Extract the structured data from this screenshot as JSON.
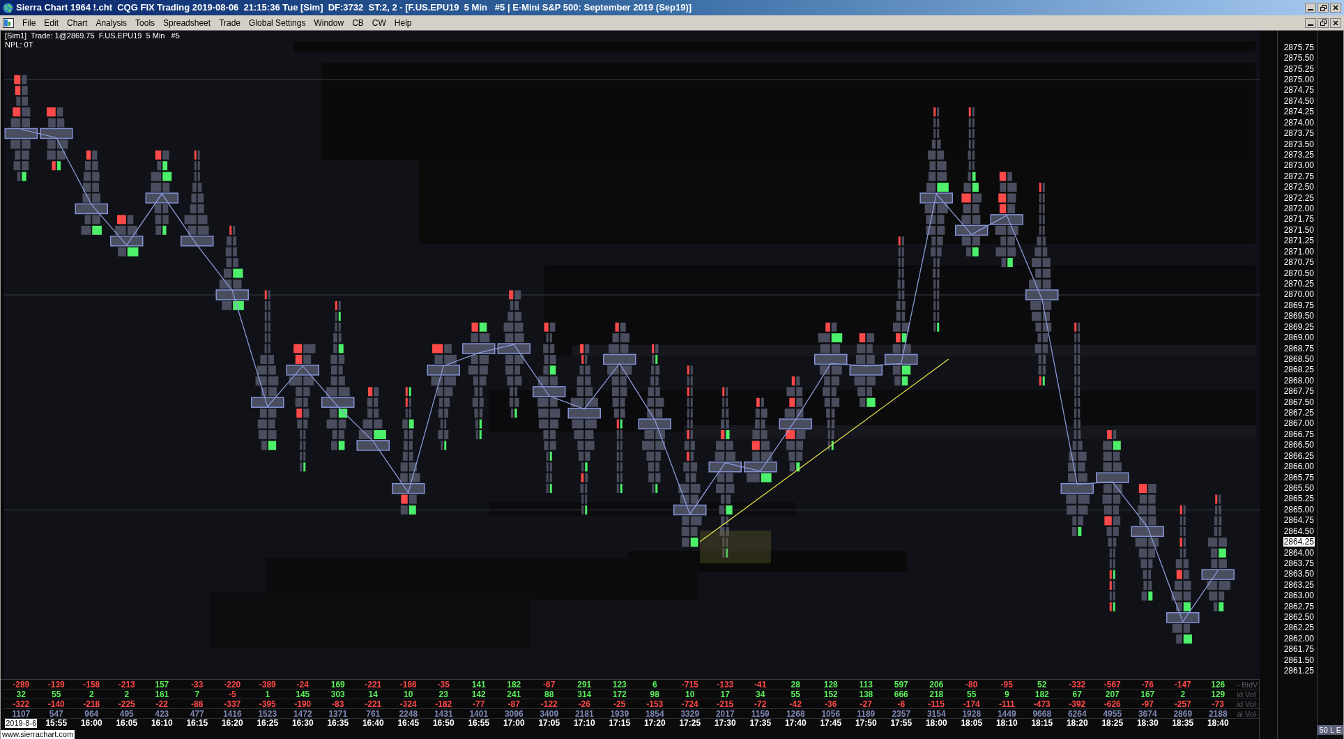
{
  "title_bar": {
    "title": "Sierra Chart 1964 !.cht  CQG FIX Trading 2019-08-06  21:15:36 Tue [Sim]  DF:3732  ST:2, 2 - [F.US.EPU19  5 Min   #5 | E-Mini S&P 500: September 2019 (Sep19)]"
  },
  "menu": [
    "File",
    "Edit",
    "Chart",
    "Analysis",
    "Tools",
    "Spreadsheet",
    "Trade",
    "Global Settings",
    "Window",
    "CB",
    "CW",
    "Help"
  ],
  "chart_info": {
    "line_1": "[Sim1]  Trade: 1@2869.75  F.US.EPU19  5 Min   #5",
    "line_2": "NPL: 0T"
  },
  "price_axis": [
    {
      "label": "2875.75",
      "current": false
    },
    {
      "label": "2875.50",
      "current": false
    },
    {
      "label": "2875.25",
      "current": false
    },
    {
      "label": "2875.00",
      "current": false
    },
    {
      "label": "2874.75",
      "current": false
    },
    {
      "label": "2874.50",
      "current": false
    },
    {
      "label": "2874.25",
      "current": false
    },
    {
      "label": "2874.00",
      "current": false
    },
    {
      "label": "2873.75",
      "current": false
    },
    {
      "label": "2873.50",
      "current": false
    },
    {
      "label": "2873.25",
      "current": false
    },
    {
      "label": "2873.00",
      "current": false
    },
    {
      "label": "2872.75",
      "current": false
    },
    {
      "label": "2872.50",
      "current": false
    },
    {
      "label": "2872.25",
      "current": false
    },
    {
      "label": "2872.00",
      "current": false
    },
    {
      "label": "2871.75",
      "current": false
    },
    {
      "label": "2871.50",
      "current": false
    },
    {
      "label": "2871.25",
      "current": false
    },
    {
      "label": "2871.00",
      "current": false
    },
    {
      "label": "2870.75",
      "current": false
    },
    {
      "label": "2870.50",
      "current": false
    },
    {
      "label": "2870.25",
      "current": false
    },
    {
      "label": "2870.00",
      "current": false
    },
    {
      "label": "2869.75",
      "current": false
    },
    {
      "label": "2869.50",
      "current": false
    },
    {
      "label": "2869.25",
      "current": false
    },
    {
      "label": "2869.00",
      "current": false
    },
    {
      "label": "2868.75",
      "current": false
    },
    {
      "label": "2868.50",
      "current": false
    },
    {
      "label": "2868.25",
      "current": false
    },
    {
      "label": "2868.00",
      "current": false
    },
    {
      "label": "2867.75",
      "current": false
    },
    {
      "label": "2867.50",
      "current": false
    },
    {
      "label": "2867.25",
      "current": false
    },
    {
      "label": "2867.00",
      "current": false
    },
    {
      "label": "2866.75",
      "current": false
    },
    {
      "label": "2866.50",
      "current": false
    },
    {
      "label": "2866.25",
      "current": false
    },
    {
      "label": "2866.00",
      "current": false
    },
    {
      "label": "2865.75",
      "current": false
    },
    {
      "label": "2865.50",
      "current": false
    },
    {
      "label": "2865.25",
      "current": false
    },
    {
      "label": "2865.00",
      "current": false
    },
    {
      "label": "2864.75",
      "current": false
    },
    {
      "label": "2864.50",
      "current": false
    },
    {
      "label": "2864.25",
      "current": true
    },
    {
      "label": "2864.00",
      "current": false
    },
    {
      "label": "2863.75",
      "current": false
    },
    {
      "label": "2863.50",
      "current": false
    },
    {
      "label": "2863.25",
      "current": false
    },
    {
      "label": "2863.00",
      "current": false
    },
    {
      "label": "2862.75",
      "current": false
    },
    {
      "label": "2862.50",
      "current": false
    },
    {
      "label": "2862.25",
      "current": false
    },
    {
      "label": "2862.00",
      "current": false
    },
    {
      "label": "2861.75",
      "current": false
    },
    {
      "label": "2861.50",
      "current": false
    },
    {
      "label": "2861.25",
      "current": false
    }
  ],
  "study_table": {
    "rows": [
      {
        "label": "- BidV",
        "cells": [
          {
            "value": "-289",
            "color": "#ff4848"
          },
          {
            "value": "-139",
            "color": "#ff4848"
          },
          {
            "value": "-158",
            "color": "#ff4848"
          },
          {
            "value": "-213",
            "color": "#ff4848"
          },
          {
            "value": "157",
            "color": "#5cf05c"
          },
          {
            "value": "-33",
            "color": "#ff4848"
          },
          {
            "value": "-220",
            "color": "#ff4848"
          },
          {
            "value": "-389",
            "color": "#ff4848"
          },
          {
            "value": "-24",
            "color": "#ff4848"
          },
          {
            "value": "169",
            "color": "#5cf05c"
          },
          {
            "value": "-221",
            "color": "#ff4848"
          },
          {
            "value": "-186",
            "color": "#ff4848"
          },
          {
            "value": "-35",
            "color": "#ff4848"
          },
          {
            "value": "141",
            "color": "#5cf05c"
          },
          {
            "value": "182",
            "color": "#5cf05c"
          },
          {
            "value": "-67",
            "color": "#ff4848"
          },
          {
            "value": "291",
            "color": "#5cf05c"
          },
          {
            "value": "123",
            "color": "#5cf05c"
          },
          {
            "value": "6",
            "color": "#5cf05c"
          },
          {
            "value": "-715",
            "color": "#ff4848"
          },
          {
            "value": "-133",
            "color": "#ff4848"
          },
          {
            "value": "-41",
            "color": "#ff4848"
          },
          {
            "value": "28",
            "color": "#5cf05c"
          },
          {
            "value": "128",
            "color": "#5cf05c"
          },
          {
            "value": "113",
            "color": "#5cf05c"
          },
          {
            "value": "597",
            "color": "#5cf05c"
          },
          {
            "value": "206",
            "color": "#5cf05c"
          },
          {
            "value": "-80",
            "color": "#ff4848"
          },
          {
            "value": "-95",
            "color": "#ff4848"
          },
          {
            "value": "52",
            "color": "#5cf05c"
          },
          {
            "value": "-332",
            "color": "#ff4848"
          },
          {
            "value": "-567",
            "color": "#ff4848"
          },
          {
            "value": "-76",
            "color": "#ff4848"
          },
          {
            "value": "-147",
            "color": "#ff4848"
          },
          {
            "value": "126",
            "color": "#5cf05c"
          }
        ]
      },
      {
        "label": "id Vol",
        "cells": [
          {
            "value": "32",
            "color": "#5cf05c"
          },
          {
            "value": "55",
            "color": "#5cf05c"
          },
          {
            "value": "2",
            "color": "#5cf05c"
          },
          {
            "value": "2",
            "color": "#5cf05c"
          },
          {
            "value": "161",
            "color": "#5cf05c"
          },
          {
            "value": "7",
            "color": "#5cf05c"
          },
          {
            "value": "-5",
            "color": "#ff4848"
          },
          {
            "value": "1",
            "color": "#5cf05c"
          },
          {
            "value": "145",
            "color": "#5cf05c"
          },
          {
            "value": "303",
            "color": "#5cf05c"
          },
          {
            "value": "14",
            "color": "#5cf05c"
          },
          {
            "value": "10",
            "color": "#5cf05c"
          },
          {
            "value": "23",
            "color": "#5cf05c"
          },
          {
            "value": "142",
            "color": "#5cf05c"
          },
          {
            "value": "241",
            "color": "#5cf05c"
          },
          {
            "value": "88",
            "color": "#5cf05c"
          },
          {
            "value": "314",
            "color": "#5cf05c"
          },
          {
            "value": "172",
            "color": "#5cf05c"
          },
          {
            "value": "98",
            "color": "#5cf05c"
          },
          {
            "value": "10",
            "color": "#5cf05c"
          },
          {
            "value": "17",
            "color": "#5cf05c"
          },
          {
            "value": "34",
            "color": "#5cf05c"
          },
          {
            "value": "55",
            "color": "#5cf05c"
          },
          {
            "value": "152",
            "color": "#5cf05c"
          },
          {
            "value": "138",
            "color": "#5cf05c"
          },
          {
            "value": "666",
            "color": "#5cf05c"
          },
          {
            "value": "218",
            "color": "#5cf05c"
          },
          {
            "value": "55",
            "color": "#5cf05c"
          },
          {
            "value": "9",
            "color": "#5cf05c"
          },
          {
            "value": "182",
            "color": "#5cf05c"
          },
          {
            "value": "67",
            "color": "#5cf05c"
          },
          {
            "value": "207",
            "color": "#5cf05c"
          },
          {
            "value": "167",
            "color": "#5cf05c"
          },
          {
            "value": "2",
            "color": "#5cf05c"
          },
          {
            "value": "129",
            "color": "#5cf05c"
          }
        ]
      },
      {
        "label": "id Vol",
        "cells": [
          {
            "value": "-322",
            "color": "#ff4848"
          },
          {
            "value": "-140",
            "color": "#ff4848"
          },
          {
            "value": "-218",
            "color": "#ff4848"
          },
          {
            "value": "-225",
            "color": "#ff4848"
          },
          {
            "value": "-22",
            "color": "#ff4848"
          },
          {
            "value": "-88",
            "color": "#ff4848"
          },
          {
            "value": "-337",
            "color": "#ff4848"
          },
          {
            "value": "-395",
            "color": "#ff4848"
          },
          {
            "value": "-190",
            "color": "#ff4848"
          },
          {
            "value": "-83",
            "color": "#ff4848"
          },
          {
            "value": "-221",
            "color": "#ff4848"
          },
          {
            "value": "-324",
            "color": "#ff4848"
          },
          {
            "value": "-182",
            "color": "#ff4848"
          },
          {
            "value": "-77",
            "color": "#ff4848"
          },
          {
            "value": "-87",
            "color": "#ff4848"
          },
          {
            "value": "-122",
            "color": "#ff4848"
          },
          {
            "value": "-26",
            "color": "#ff4848"
          },
          {
            "value": "-25",
            "color": "#ff4848"
          },
          {
            "value": "-153",
            "color": "#ff4848"
          },
          {
            "value": "-724",
            "color": "#ff4848"
          },
          {
            "value": "-215",
            "color": "#ff4848"
          },
          {
            "value": "-72",
            "color": "#ff4848"
          },
          {
            "value": "-42",
            "color": "#ff4848"
          },
          {
            "value": "-36",
            "color": "#ff4848"
          },
          {
            "value": "-27",
            "color": "#ff4848"
          },
          {
            "value": "-8",
            "color": "#ff4848"
          },
          {
            "value": "-115",
            "color": "#ff4848"
          },
          {
            "value": "-174",
            "color": "#ff4848"
          },
          {
            "value": "-111",
            "color": "#ff4848"
          },
          {
            "value": "-473",
            "color": "#ff4848"
          },
          {
            "value": "-392",
            "color": "#ff4848"
          },
          {
            "value": "-626",
            "color": "#ff4848"
          },
          {
            "value": "-97",
            "color": "#ff4848"
          },
          {
            "value": "-257",
            "color": "#ff4848"
          },
          {
            "value": "-73",
            "color": "#ff4848"
          }
        ]
      },
      {
        "label": "al Vol",
        "cells": [
          {
            "value": "1107",
            "color": "#7d87b5"
          },
          {
            "value": "547",
            "color": "#7d87b5"
          },
          {
            "value": "964",
            "color": "#7d87b5"
          },
          {
            "value": "495",
            "color": "#7d87b5"
          },
          {
            "value": "423",
            "color": "#7d87b5"
          },
          {
            "value": "477",
            "color": "#7d87b5"
          },
          {
            "value": "1416",
            "color": "#7d87b5"
          },
          {
            "value": "1523",
            "color": "#7d87b5"
          },
          {
            "value": "1472",
            "color": "#7d87b5"
          },
          {
            "value": "1371",
            "color": "#7d87b5"
          },
          {
            "value": "761",
            "color": "#7d87b5"
          },
          {
            "value": "2248",
            "color": "#7d87b5"
          },
          {
            "value": "1431",
            "color": "#7d87b5"
          },
          {
            "value": "1401",
            "color": "#7d87b5"
          },
          {
            "value": "3096",
            "color": "#7d87b5"
          },
          {
            "value": "3409",
            "color": "#7d87b5"
          },
          {
            "value": "2181",
            "color": "#7d87b5"
          },
          {
            "value": "1939",
            "color": "#7d87b5"
          },
          {
            "value": "1854",
            "color": "#7d87b5"
          },
          {
            "value": "3329",
            "color": "#7d87b5"
          },
          {
            "value": "2017",
            "color": "#7d87b5"
          },
          {
            "value": "1159",
            "color": "#7d87b5"
          },
          {
            "value": "1268",
            "color": "#7d87b5"
          },
          {
            "value": "1056",
            "color": "#7d87b5"
          },
          {
            "value": "1189",
            "color": "#7d87b5"
          },
          {
            "value": "2357",
            "color": "#7d87b5"
          },
          {
            "value": "3154",
            "color": "#7d87b5"
          },
          {
            "value": "1928",
            "color": "#7d87b5"
          },
          {
            "value": "1449",
            "color": "#7d87b5"
          },
          {
            "value": "9668",
            "color": "#7d87b5"
          },
          {
            "value": "6264",
            "color": "#7d87b5"
          },
          {
            "value": "4955",
            "color": "#7d87b5"
          },
          {
            "value": "3674",
            "color": "#7d87b5"
          },
          {
            "value": "2869",
            "color": "#7d87b5"
          },
          {
            "value": "2188",
            "color": "#7d87b5"
          }
        ]
      }
    ]
  },
  "time_axis": [
    {
      "label": "2019-8-6",
      "kind": "date"
    },
    {
      "label": "15:55",
      "kind": "time"
    },
    {
      "label": "16:00",
      "kind": "time"
    },
    {
      "label": "16:05",
      "kind": "time"
    },
    {
      "label": "16:10",
      "kind": "time"
    },
    {
      "label": "16:15",
      "kind": "time"
    },
    {
      "label": "16:20",
      "kind": "time"
    },
    {
      "label": "16:25",
      "kind": "time"
    },
    {
      "label": "16:30",
      "kind": "time"
    },
    {
      "label": "16:35",
      "kind": "time"
    },
    {
      "label": "16:40",
      "kind": "time"
    },
    {
      "label": "16:45",
      "kind": "time"
    },
    {
      "label": "16:50",
      "kind": "time"
    },
    {
      "label": "16:55",
      "kind": "time"
    },
    {
      "label": "17:00",
      "kind": "time"
    },
    {
      "label": "17:05",
      "kind": "time"
    },
    {
      "label": "17:10",
      "kind": "time"
    },
    {
      "label": "17:15",
      "kind": "time"
    },
    {
      "label": "17:20",
      "kind": "time"
    },
    {
      "label": "17:25",
      "kind": "time"
    },
    {
      "label": "17:30",
      "kind": "time"
    },
    {
      "label": "17:35",
      "kind": "time"
    },
    {
      "label": "17:40",
      "kind": "time"
    },
    {
      "label": "17:45",
      "kind": "time"
    },
    {
      "label": "17:50",
      "kind": "time"
    },
    {
      "label": "17:55",
      "kind": "time"
    },
    {
      "label": "18:00",
      "kind": "time"
    },
    {
      "label": "18:05",
      "kind": "time"
    },
    {
      "label": "18:10",
      "kind": "time"
    },
    {
      "label": "18:15",
      "kind": "time"
    },
    {
      "label": "18:20",
      "kind": "time"
    },
    {
      "label": "18:25",
      "kind": "time"
    },
    {
      "label": "18:30",
      "kind": "time"
    },
    {
      "label": "18:35",
      "kind": "time"
    },
    {
      "label": "18:40",
      "kind": "time"
    }
  ],
  "footer": {
    "website": "www.sierrachart.com",
    "badge": "50 L E"
  }
}
